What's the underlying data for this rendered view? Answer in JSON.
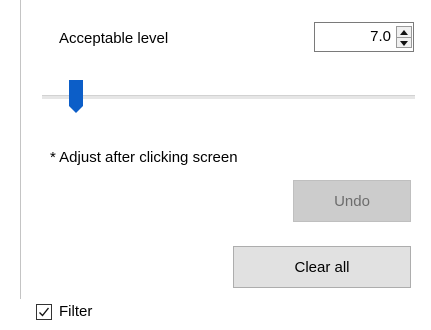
{
  "acceptable_level": {
    "label": "Acceptable level",
    "value": "7.0"
  },
  "slider": {
    "min": 0,
    "max": 100,
    "value": 9,
    "accent_color": "#0c5ec8"
  },
  "hint": "* Adjust after clicking screen",
  "buttons": {
    "undo_label": "Undo",
    "undo_enabled": false,
    "clear_label": "Clear all"
  },
  "filter": {
    "label": "Filter",
    "checked": true
  },
  "icons": {
    "spin_up": "chevron-up-icon",
    "spin_down": "chevron-down-icon",
    "check": "checkmark-icon",
    "thumb": "slider-thumb"
  }
}
